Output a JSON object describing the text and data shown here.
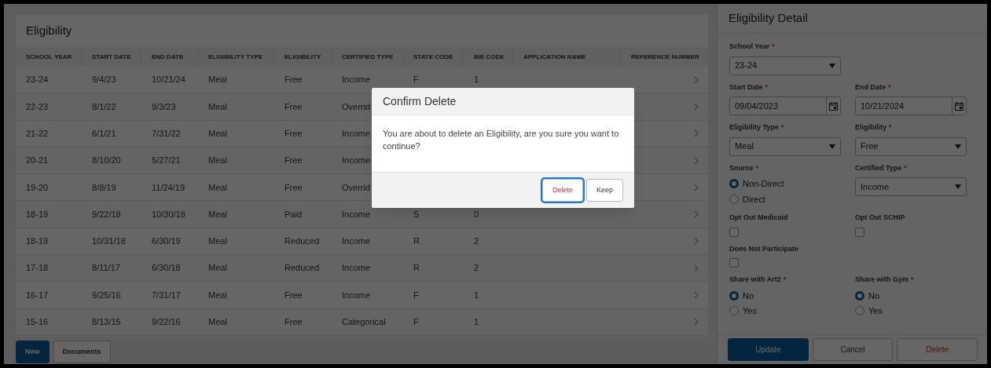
{
  "table": {
    "title": "Eligibility",
    "columns": [
      "SCHOOL YEAR",
      "START DATE",
      "END DATE",
      "ELIGIBILITY TYPE",
      "ELIGIBILITY",
      "CERTIFIED TYPE",
      "STATE CODE",
      "BIE CODE",
      "APPLICATION NAME",
      "REFERENCE NUMBER"
    ],
    "rows": [
      {
        "cells": [
          "23-24",
          "9/4/23",
          "10/21/24",
          "Meal",
          "Free",
          "Income",
          "F",
          "1"
        ]
      },
      {
        "cells": [
          "22-23",
          "8/1/22",
          "9/3/23",
          "Meal",
          "Free",
          "Overrid"
        ]
      },
      {
        "cells": [
          "21-22",
          "6/1/21",
          "7/31/22",
          "Meal",
          "Free",
          "Income"
        ]
      },
      {
        "cells": [
          "20-21",
          "8/10/20",
          "5/27/21",
          "Meal",
          "Free",
          "Income"
        ]
      },
      {
        "cells": [
          "19-20",
          "8/8/19",
          "11/24/19",
          "Meal",
          "Free",
          "Overrid"
        ]
      },
      {
        "cells": [
          "18-19",
          "9/22/18",
          "10/30/18",
          "Meal",
          "Paid",
          "Income",
          "S",
          "0"
        ]
      },
      {
        "cells": [
          "18-19",
          "10/31/18",
          "6/30/19",
          "Meal",
          "Reduced",
          "Income",
          "R",
          "2"
        ]
      },
      {
        "cells": [
          "17-18",
          "8/11/17",
          "6/30/18",
          "Meal",
          "Reduced",
          "Income",
          "R",
          "2"
        ]
      },
      {
        "cells": [
          "16-17",
          "9/25/16",
          "7/31/17",
          "Meal",
          "Free",
          "Income",
          "F",
          "1"
        ]
      },
      {
        "cells": [
          "15-16",
          "8/13/15",
          "9/22/16",
          "Meal",
          "Free",
          "Categorical",
          "F",
          "1"
        ]
      }
    ]
  },
  "table_buttons": [
    {
      "label": "New",
      "kind": "primary"
    },
    {
      "label": "Documents",
      "kind": "secondary"
    }
  ],
  "detail": {
    "title": "Eligibility Detail",
    "rows": [
      [
        {
          "kind": "select",
          "label": "School Year",
          "required_mark": "*",
          "value": "23-24"
        }
      ],
      [
        {
          "kind": "date",
          "label": "Start Date",
          "required_mark": "*",
          "value": "09/04/2023"
        },
        {
          "kind": "date",
          "label": "End Date",
          "required_mark": "*",
          "value": "10/21/2024"
        }
      ],
      [
        {
          "kind": "select",
          "label": "Eligibility Type",
          "required_mark": "*",
          "value": "Meal"
        },
        {
          "kind": "select",
          "label": "Eligibility",
          "required_mark": "*",
          "value": "Free"
        }
      ],
      [
        {
          "kind": "radio",
          "label": "Source",
          "required_mark": "*",
          "options": [
            {
              "label": "Non-Direct",
              "selected": true
            },
            {
              "label": "Direct",
              "selected": false
            }
          ]
        },
        {
          "kind": "select",
          "label": "Certified Type",
          "required_mark": "*",
          "value": "Income"
        }
      ],
      [
        {
          "kind": "checkbox",
          "label": "Opt Out Medicaid",
          "checked": false
        },
        {
          "kind": "checkbox",
          "label": "Opt Out SCHIP",
          "checked": false
        }
      ],
      [
        {
          "kind": "checkbox",
          "label": "Does Not Participate",
          "checked": false
        }
      ],
      [
        {
          "kind": "radio",
          "label": "Share with Art2",
          "required_mark": "*",
          "options": [
            {
              "label": "No",
              "selected": true
            },
            {
              "label": "Yes",
              "selected": false
            }
          ]
        },
        {
          "kind": "radio",
          "label": "Share with Gym",
          "required_mark": "*",
          "options": [
            {
              "label": "No",
              "selected": true
            },
            {
              "label": "Yes",
              "selected": false
            }
          ]
        }
      ]
    ]
  },
  "detail_buttons": [
    {
      "label": "Update",
      "kind": "primary"
    },
    {
      "label": "Cancel",
      "kind": "secondary"
    },
    {
      "label": "Delete",
      "kind": "danger"
    }
  ],
  "dialog": {
    "title": "Confirm Delete",
    "message": "You are about to delete an Eligibility, are you sure you want to continue?",
    "buttons": [
      {
        "label": "Delete",
        "kind": "danger",
        "focused": true
      },
      {
        "label": "Keep",
        "kind": "secondary",
        "focused": false
      }
    ]
  }
}
